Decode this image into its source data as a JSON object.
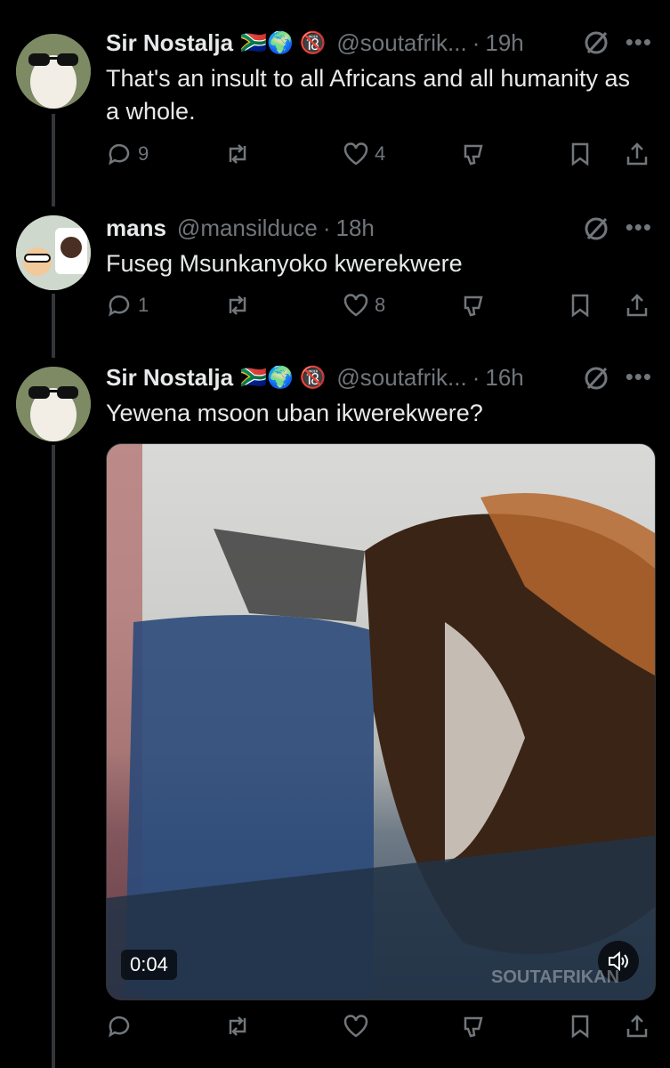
{
  "tweets": [
    {
      "name": "Sir Nostalja",
      "flags": "🇿🇦🌍 🔞",
      "handle": "@soutafrik...",
      "time": "19h",
      "text": "That's an insult to all Africans and all humanity as a whole.",
      "replies": "9",
      "retweets": "",
      "likes": "4"
    },
    {
      "name": "mans",
      "flags": "",
      "handle": "@mansilduce",
      "time": "18h",
      "text": "Fuseg Msunkanyoko kwerekwere",
      "replies": "1",
      "retweets": "",
      "likes": "8"
    },
    {
      "name": "Sir Nostalja",
      "flags": "🇿🇦🌍 🔞",
      "handle": "@soutafrik...",
      "time": "16h",
      "text": "Yewena msoon uban ikwerekwere?",
      "replies": "",
      "retweets": "",
      "likes": "",
      "video": {
        "duration": "0:04",
        "watermark": "SOUTAFRIKAN"
      }
    }
  ],
  "icons": {
    "reply": "reply-icon",
    "retweet": "retweet-icon",
    "like": "heart-icon",
    "dislike": "dislike-icon",
    "bookmark": "bookmark-icon",
    "share": "share-icon",
    "grok": "grok-icon",
    "more": "more-icon",
    "volume": "volume-icon"
  },
  "colors": {
    "background": "#000000",
    "text": "#e7e9ea",
    "muted": "#71767b",
    "thread_line": "#333639"
  }
}
